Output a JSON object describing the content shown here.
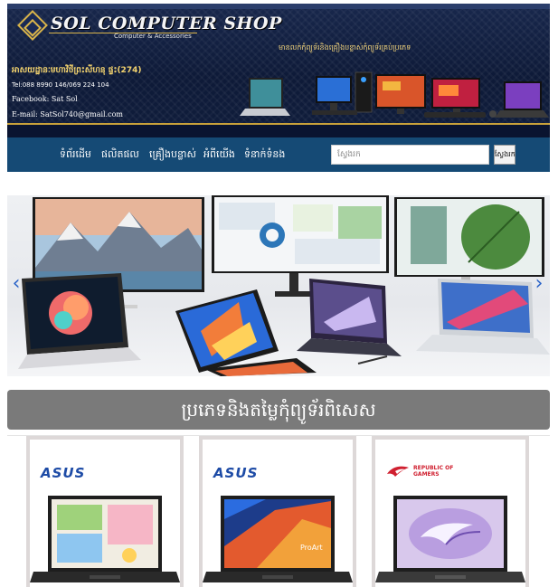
{
  "header": {
    "brand_name": "SOL COMPUTER SHOP",
    "brand_subtitle": "Computer & Accessories",
    "tagline": "មានលក់កុំព្យូទ័រនិងគ្រឿងបន្លាស់កុំព្យូទ័រគ្រប់ប្រភេទ",
    "shop_location": "អាសយដ្ឋានៈមហាវិថីព្រះសីហនុ ផ្ទះ(274)",
    "phone": "Tel:088 8990 146/069 224 104",
    "facebook": "Facebook: Sat Sol",
    "email": "E-mail: SatSol740@gmail.com"
  },
  "nav": {
    "items": [
      "ទំព័រដើម",
      "ផលិតផល",
      "គ្រឿងបន្លាស់",
      "អំពីយើង",
      "ទំនាក់ទំនង"
    ],
    "search_placeholder": "ស្វែងរក",
    "search_button": "ស្វែងរក"
  },
  "carousel": {
    "prev_label": "‹",
    "next_label": "›"
  },
  "section": {
    "title": "ប្រភេទនិងតម្លៃកុំព្យូទ័រពិសេស"
  },
  "products": [
    {
      "brand": "ASUS",
      "screen_theme": "light"
    },
    {
      "brand": "ASUS",
      "screen_theme": "proart",
      "screen_text": "ProArt"
    },
    {
      "brand": "ROG",
      "brand_line1": "REPUBLIC OF",
      "brand_line2": "GAMERS",
      "screen_theme": "rog"
    }
  ],
  "colors": {
    "nav_bg": "#154a75",
    "banner_bg": "#0e1a38",
    "gold": "#d9b44a",
    "section_bg": "#7a7a7a",
    "asus_blue": "#1d4ba6",
    "rog_red": "#d02030",
    "arrow": "#2a63c8"
  }
}
